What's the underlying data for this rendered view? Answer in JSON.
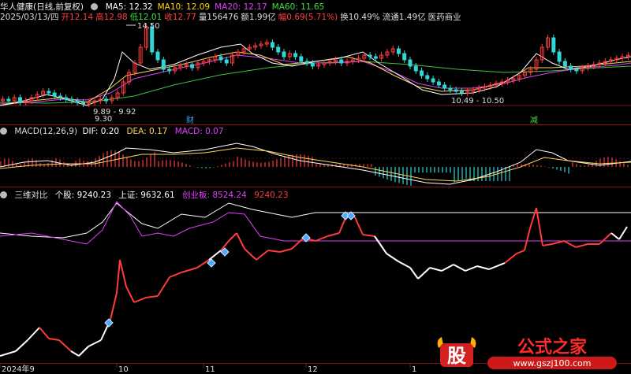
{
  "panel_top": {
    "stock_name": "华人健康(日线,前复权)",
    "ma": [
      {
        "label": "MA5: 12.32",
        "color": "#ffffff"
      },
      {
        "label": "MA10: 12.09",
        "color": "#ffd700"
      },
      {
        "label": "MA20: 12.17",
        "color": "#e040fb"
      },
      {
        "label": "MA60: 11.65",
        "color": "#40e040"
      }
    ],
    "quote": [
      {
        "text": "2025/03/13/四",
        "color": "#dddddd"
      },
      {
        "text": "开12.14",
        "color": "#ff4040"
      },
      {
        "text": "高12.98",
        "color": "#ff4040"
      },
      {
        "text": "低12.01",
        "color": "#40e040"
      },
      {
        "text": "收12.77",
        "color": "#ff4040"
      },
      {
        "text": "量156476",
        "color": "#dddddd"
      },
      {
        "text": "额1.99亿",
        "color": "#dddddd"
      },
      {
        "text": "幅0.69(5.71%)",
        "color": "#ff4040"
      },
      {
        "text": "换10.49%",
        "color": "#dddddd"
      },
      {
        "text": "流通1.49亿",
        "color": "#dddddd"
      },
      {
        "text": "医药商业",
        "color": "#dddddd"
      }
    ],
    "annotations": {
      "high": "14.50",
      "low1": "9.30",
      "range1": "9.89 - 9.92",
      "range2": "10.49 - 10.50",
      "tag1": "财",
      "tag2": "减"
    }
  },
  "panel_macd": {
    "label": "MACD(12,26,9)",
    "dif": "DIF: 0.20",
    "dea": "DEA: 0.17",
    "macd": "MACD: 0.07"
  },
  "panel_compare": {
    "label": "三维对比",
    "stock": "个股: 9240.23",
    "index1": "上证: 9632.61",
    "index2": "创业板: 8524.24",
    "value": "9240.23"
  },
  "xaxis": [
    "2024年9",
    "10",
    "11",
    "12",
    "1"
  ],
  "watermark": {
    "logo": "股",
    "title": "公式之家",
    "url": "www.gszj100.com"
  },
  "colors": {
    "up": "#ff3b3b",
    "down": "#31d6d6",
    "ma60": "#3fbf3f",
    "macd_dea": "#ffd75a"
  }
}
